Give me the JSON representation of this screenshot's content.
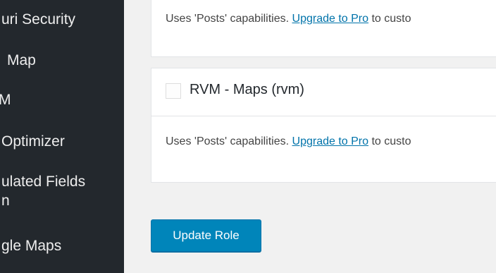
{
  "sidebar": {
    "items": [
      {
        "label": "uri Security"
      },
      {
        "label": "Map"
      },
      {
        "label": "M"
      },
      {
        "label": "Optimizer"
      },
      {
        "label": "ulated Fields"
      },
      {
        "label": "n"
      },
      {
        "label": "gle Maps"
      }
    ]
  },
  "main": {
    "cards": [
      {
        "description_prefix": "Uses 'Posts' capabilities. ",
        "upgrade_link": "Upgrade to Pro",
        "description_suffix": " to custo"
      },
      {
        "title": "RVM - Maps (rvm)",
        "description_prefix": "Uses 'Posts' capabilities. ",
        "upgrade_link": "Upgrade to Pro",
        "description_suffix": " to custo"
      }
    ],
    "update_button_label": "Update Role"
  }
}
